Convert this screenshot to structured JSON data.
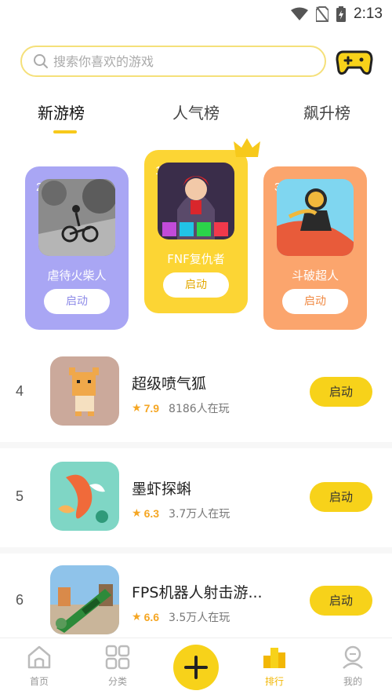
{
  "status_bar": {
    "time": "2:13",
    "icons": [
      "wifi-icon",
      "no-sim-icon",
      "battery-icon"
    ]
  },
  "search": {
    "placeholder": "搜索你喜欢的游戏"
  },
  "header": {
    "action_icon": "gamepad-icon"
  },
  "tabs": [
    {
      "label": "新游榜",
      "active": true
    },
    {
      "label": "人气榜",
      "active": false
    },
    {
      "label": "飙升榜",
      "active": false
    }
  ],
  "podium": [
    {
      "rank": "2",
      "name": "虐待火柴人",
      "button": "启动",
      "color": "#a9a6f4",
      "button_text_color": "#8f8ce8"
    },
    {
      "rank": "1",
      "name": "FNF复仇者",
      "button": "启动",
      "color": "#fcd534",
      "button_text_color": "#e3a800"
    },
    {
      "rank": "3",
      "name": "斗破超人",
      "button": "启动",
      "color": "#fba56d",
      "button_text_color": "#f08a44"
    }
  ],
  "list": [
    {
      "rank": "4",
      "title": "超级喷气狐",
      "rating": "7.9",
      "players": "8186人在玩",
      "button": "启动"
    },
    {
      "rank": "5",
      "title": "墨虾探蝌",
      "rating": "6.3",
      "players": "3.7万人在玩",
      "button": "启动"
    },
    {
      "rank": "6",
      "title": "FPS机器人射击游...",
      "rating": "6.6",
      "players": "3.5万人在玩",
      "button": "启动"
    }
  ],
  "bottom_nav": [
    {
      "label": "首页",
      "icon": "home-icon",
      "active": false
    },
    {
      "label": "分类",
      "icon": "grid-icon",
      "active": false
    },
    {
      "label": "",
      "icon": "plus-icon",
      "active": false
    },
    {
      "label": "排行",
      "icon": "ranking-icon",
      "active": true
    },
    {
      "label": "我的",
      "icon": "profile-icon",
      "active": false
    }
  ],
  "colors": {
    "accent": "#f7d21a",
    "active_nav": "#f2b705",
    "rating": "#f5a623"
  }
}
